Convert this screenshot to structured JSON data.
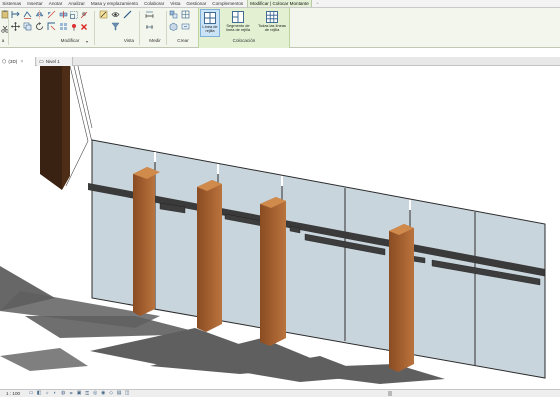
{
  "ribbon_tabs": [
    {
      "label": "Sistemas"
    },
    {
      "label": "Insertar"
    },
    {
      "label": "Anotar"
    },
    {
      "label": "Analizar"
    },
    {
      "label": "Masa y emplazamiento"
    },
    {
      "label": "Colaborar"
    },
    {
      "label": "Vista"
    },
    {
      "label": "Gestionar"
    },
    {
      "label": "Complementos"
    },
    {
      "label": "Modificar | Colocar Montante",
      "active": true
    }
  ],
  "panels": {
    "modificar": "Modificar",
    "vista": "Vista",
    "medir": "Medir",
    "crear": "Crear",
    "colocacion": "Colocación",
    "left_partial": "a"
  },
  "colocacion_buttons": {
    "grid_line": "Línea de rejilla",
    "grid_line_segment": "Segmento de línea de rejilla",
    "all_grid_lines": "Todas las líneas de rejilla"
  },
  "view_tabs": [
    {
      "label": "(3D)",
      "icon": "3d-view-icon"
    },
    {
      "label": "Nivel 1",
      "icon": "floor-plan-icon"
    }
  ],
  "status": {
    "scale": "1 : 100"
  },
  "colors": {
    "accent": "#3c78b4",
    "context_tab": "#e4f1d6",
    "glass": "#c9d5dc",
    "wood": "#a86332",
    "shadow": "#5f5f5f"
  }
}
